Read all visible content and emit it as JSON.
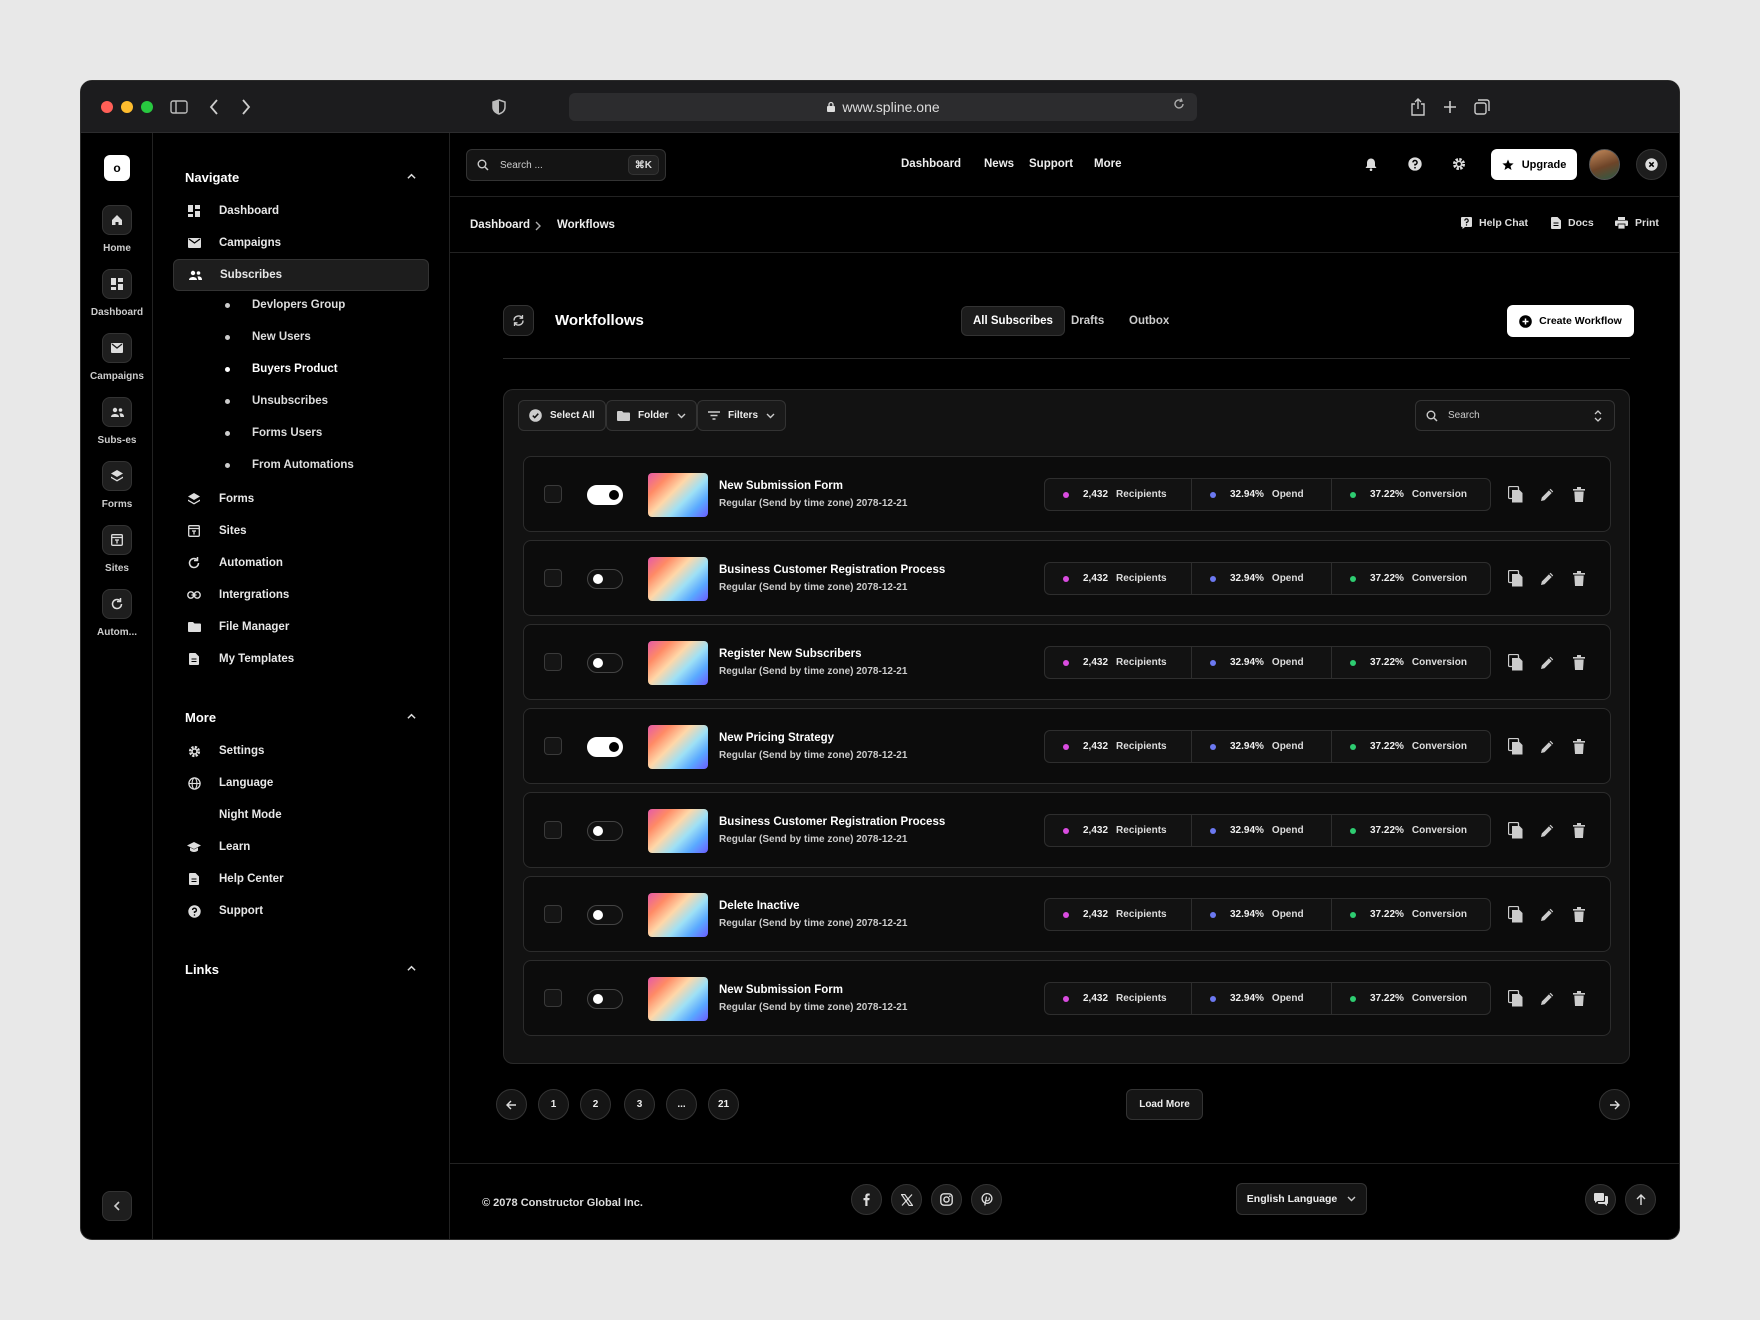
{
  "browser": {
    "url": "www.spline.one"
  },
  "rail": {
    "logo": "o",
    "items": [
      {
        "label": "Home",
        "icon": "home-icon"
      },
      {
        "label": "Dashboard",
        "icon": "dashboard-icon"
      },
      {
        "label": "Campaigns",
        "icon": "mail-icon"
      },
      {
        "label": "Subs-es",
        "icon": "users-icon"
      },
      {
        "label": "Forms",
        "icon": "layers-icon"
      },
      {
        "label": "Sites",
        "icon": "sites-icon"
      },
      {
        "label": "Autom...",
        "icon": "refresh-icon"
      }
    ]
  },
  "sidebar": {
    "navigate_title": "Navigate",
    "navigate_items": [
      {
        "label": "Dashboard",
        "icon": "dashboard-icon"
      },
      {
        "label": "Campaigns",
        "icon": "mail-icon"
      },
      {
        "label": "Subscribes",
        "icon": "users-icon",
        "active": true
      }
    ],
    "sub_items": [
      {
        "label": "Devlopers Group"
      },
      {
        "label": "New Users"
      },
      {
        "label": "Buyers Product",
        "bold": true
      },
      {
        "label": "Unsubscribes"
      },
      {
        "label": "Forms Users"
      },
      {
        "label": "From Automations"
      }
    ],
    "navigate_items_2": [
      {
        "label": "Forms",
        "icon": "layers-icon"
      },
      {
        "label": "Sites",
        "icon": "sites-icon"
      },
      {
        "label": "Automation",
        "icon": "refresh-icon"
      },
      {
        "label": "Intergrations",
        "icon": "link-icon"
      },
      {
        "label": "File Manager",
        "icon": "folder-icon"
      },
      {
        "label": "My Templates",
        "icon": "document-icon"
      }
    ],
    "more_title": "More",
    "more_items": [
      {
        "label": "Settings",
        "icon": "gear-icon"
      },
      {
        "label": "Language",
        "icon": "globe-icon"
      },
      {
        "label": "Night Mode",
        "icon": "moon-icon"
      },
      {
        "label": "Learn",
        "icon": "graduation-cap-icon"
      },
      {
        "label": "Help Center",
        "icon": "document-icon"
      },
      {
        "label": "Support",
        "icon": "help-circle-icon"
      }
    ],
    "links_title": "Links"
  },
  "topbar": {
    "search_placeholder": "Search ...",
    "search_shortcut": "⌘K",
    "nav": [
      "Dashboard",
      "News",
      "Support",
      "More"
    ],
    "upgrade_label": "Upgrade"
  },
  "breadcrumb": {
    "items": [
      "Dashboard",
      "Workflows"
    ],
    "tools": [
      "Help Chat",
      "Docs",
      "Print"
    ]
  },
  "workflows": {
    "title": "Workfollows",
    "tabs": [
      {
        "label": "All Subscribes",
        "active": true
      },
      {
        "label": "Drafts"
      },
      {
        "label": "Outbox"
      }
    ],
    "create_label": "Create Workflow",
    "toolbar": {
      "select_all": "Select All",
      "folder": "Folder",
      "filters": "Filters",
      "search_placeholder": "Search"
    },
    "stat_colors": {
      "recipients": "#d94ce0",
      "opend": "#6b78f0",
      "conversion": "#2ecc71"
    },
    "rows": [
      {
        "title": "New Submission Form",
        "subtitle": "Regular (Send by time zone) 2078-12-21",
        "enabled": true,
        "recipients": "2,432",
        "recipients_label": "Recipients",
        "opend": "32.94%",
        "opend_label": "Opend",
        "conversion": "37.22%",
        "conversion_label": "Conversion"
      },
      {
        "title": "Business Customer Registration Process",
        "subtitle": "Regular (Send by time zone) 2078-12-21",
        "enabled": false,
        "recipients": "2,432",
        "recipients_label": "Recipients",
        "opend": "32.94%",
        "opend_label": "Opend",
        "conversion": "37.22%",
        "conversion_label": "Conversion"
      },
      {
        "title": "Register New Subscribers",
        "subtitle": "Regular (Send by time zone) 2078-12-21",
        "enabled": false,
        "recipients": "2,432",
        "recipients_label": "Recipients",
        "opend": "32.94%",
        "opend_label": "Opend",
        "conversion": "37.22%",
        "conversion_label": "Conversion"
      },
      {
        "title": "New Pricing Strategy",
        "subtitle": "Regular (Send by time zone) 2078-12-21",
        "enabled": true,
        "recipients": "2,432",
        "recipients_label": "Recipients",
        "opend": "32.94%",
        "opend_label": "Opend",
        "conversion": "37.22%",
        "conversion_label": "Conversion"
      },
      {
        "title": "Business Customer Registration Process",
        "subtitle": "Regular (Send by time zone) 2078-12-21",
        "enabled": false,
        "recipients": "2,432",
        "recipients_label": "Recipients",
        "opend": "32.94%",
        "opend_label": "Opend",
        "conversion": "37.22%",
        "conversion_label": "Conversion"
      },
      {
        "title": "Delete Inactive",
        "subtitle": "Regular (Send by time zone) 2078-12-21",
        "enabled": false,
        "recipients": "2,432",
        "recipients_label": "Recipients",
        "opend": "32.94%",
        "opend_label": "Opend",
        "conversion": "37.22%",
        "conversion_label": "Conversion"
      },
      {
        "title": "New Submission Form",
        "subtitle": "Regular (Send by time zone) 2078-12-21",
        "enabled": false,
        "recipients": "2,432",
        "recipients_label": "Recipients",
        "opend": "32.94%",
        "opend_label": "Opend",
        "conversion": "37.22%",
        "conversion_label": "Conversion"
      }
    ]
  },
  "pagination": {
    "pages": [
      "1",
      "2",
      "3",
      "...",
      "21"
    ],
    "load_more": "Load More"
  },
  "footer": {
    "copyright": "© 2078 Constructor Global Inc.",
    "social": [
      "facebook-icon",
      "x-icon",
      "instagram-icon",
      "pinterest-icon"
    ],
    "language": "English Language"
  }
}
